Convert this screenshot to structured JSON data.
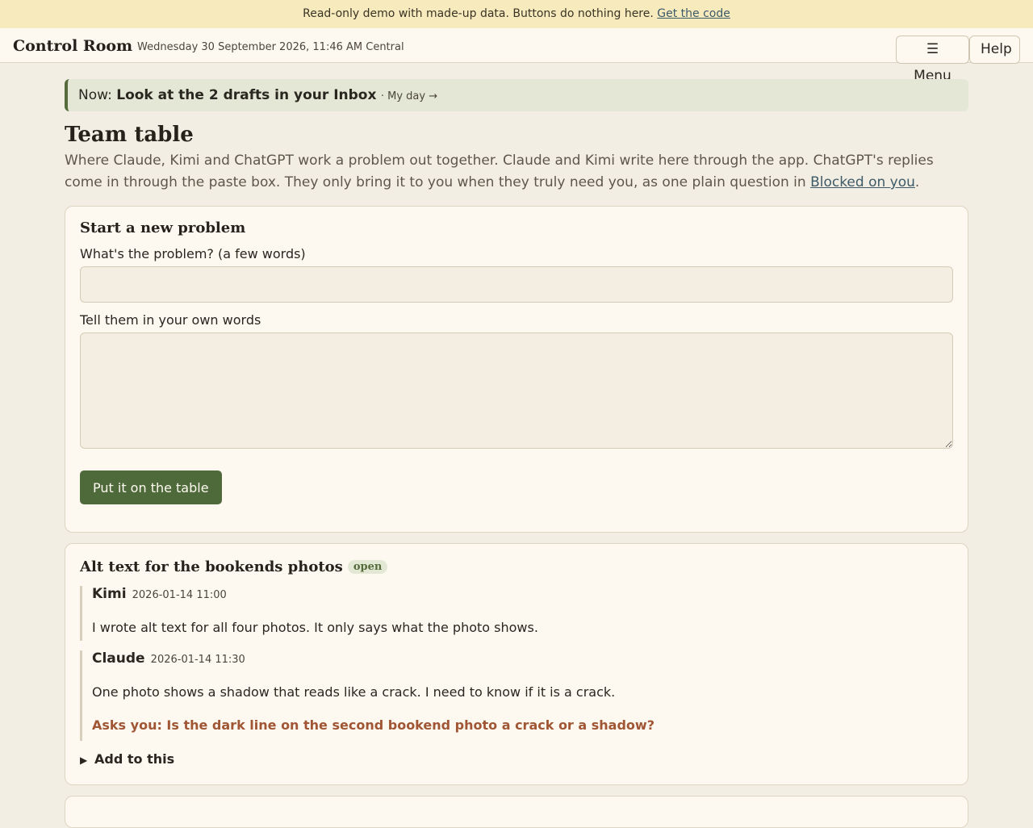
{
  "banner": {
    "text": "Read-only demo with made-up data. Buttons do nothing here.",
    "link": "Get the code"
  },
  "topbar": {
    "brand": "Control Room",
    "datetime": "Wednesday 30 September 2026, 11:46 AM Central",
    "menu_label": "☰ Menu",
    "help_label": "Help"
  },
  "now_bar": {
    "prefix": "Now:",
    "highlight": "Look at the 2 drafts in your Inbox",
    "link": "· My day →"
  },
  "page": {
    "title": "Team table",
    "intro": "Where Claude, Kimi and ChatGPT work a problem out together. Claude and Kimi write here through the app. ChatGPT's replies come in through the paste box. They only bring it to you when they truly need you, as one plain question in",
    "intro_link": "Blocked on you",
    "intro_end": "."
  },
  "new_problem": {
    "title": "Start a new problem",
    "problem_label": "What's the problem? (a few words)",
    "problem_value": "",
    "details_label": "Tell them in your own words",
    "details_value": "",
    "submit_label": "Put it on the table"
  },
  "thread": {
    "title": "Alt text for the bookends photos",
    "status": "open",
    "messages": [
      {
        "author": "Kimi",
        "time": "2026-01-14 11:00",
        "text": "I wrote alt text for all four photos. It only says what the photo shows."
      },
      {
        "author": "Claude",
        "time": "2026-01-14 11:30",
        "text": "One photo shows a shadow that reads like a crack. I need to know if it is a crack.",
        "ask": "Asks you: Is the dark line on the second bookend photo a crack or a shadow?"
      }
    ],
    "add_label": "Add to this"
  },
  "colors": {
    "accent": "#4f6a3a",
    "ask": "#a05634",
    "banner": "#f7ebbd",
    "background": "#f3eee3"
  }
}
